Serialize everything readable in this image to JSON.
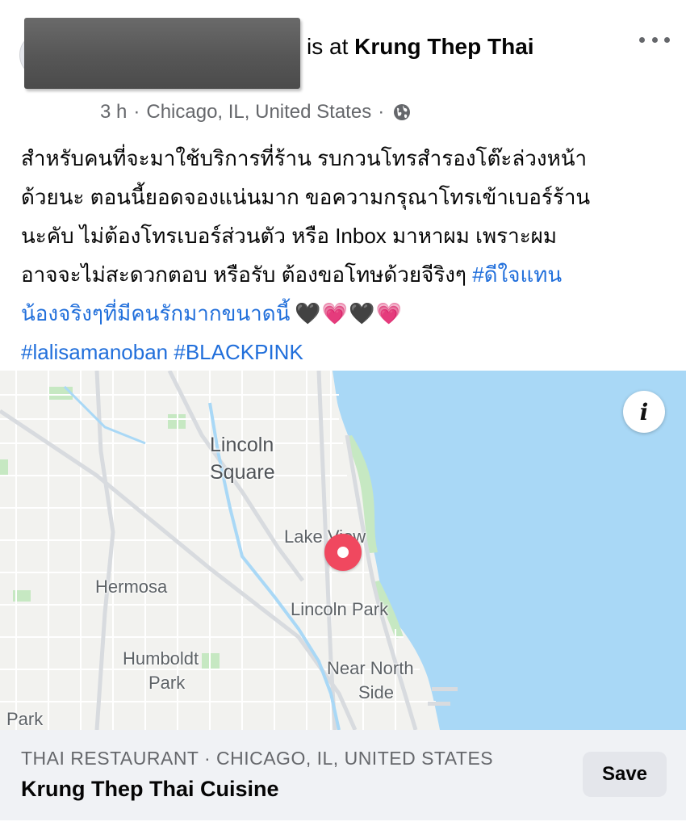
{
  "post": {
    "checkin_prefix": "is at",
    "place_name": "Krung Thep Thai",
    "time": "3 h",
    "separator": "·",
    "location": "Chicago, IL, United States",
    "audience_icon": "globe-icon",
    "more_icon": "more-horizontal-icon",
    "text_lines": [
      "สำหรับคนที่จะมาใช้บริการที่ร้าน รบกวนโทรสำรองโต๊ะล่วงหน้า",
      "ด้วยนะ  ตอนนี้ยอดจองแน่นมาก ขอความกรุณาโทรเข้าเบอร์ร้าน",
      "นะคับ  ไม่ต้องโทรเบอร์ส่วนตัว หรือ Inbox มาหาผม เพราะผม"
    ],
    "line4_text": "อาจจะไม่สะดวกตอบ หรือรับ ต้องขอโทษด้วยจีริงๆ ",
    "hashtag_thai_part1": "#ดีใจแทน",
    "hashtag_thai_part2": "น้องจริงๆที่มีคนรักมากขนาดนี้",
    "hearts": "🖤💗🖤💗",
    "hashtag_lalisa": "#lalisamanoban",
    "hashtag_blackpink": "#BLACKPINK"
  },
  "map": {
    "info_label": "i",
    "labels": {
      "lincoln_square_1": "Lincoln",
      "lincoln_square_2": "Square",
      "lake_view": "Lake View",
      "hermosa": "Hermosa",
      "lincoln_park": "Lincoln Park",
      "humboldt_1": "Humboldt",
      "humboldt_2": "Park",
      "near_north_1": "Near North",
      "near_north_2": "Side",
      "park": "Park"
    },
    "colors": {
      "land": "#f2f2ef",
      "water": "#a9d8f6",
      "park": "#c6e8c2",
      "pin": "#f0485f"
    }
  },
  "place_card": {
    "category": "THAI RESTAURANT · CHICAGO, IL, UNITED STATES",
    "name": "Krung Thep Thai Cuisine",
    "save_label": "Save"
  }
}
